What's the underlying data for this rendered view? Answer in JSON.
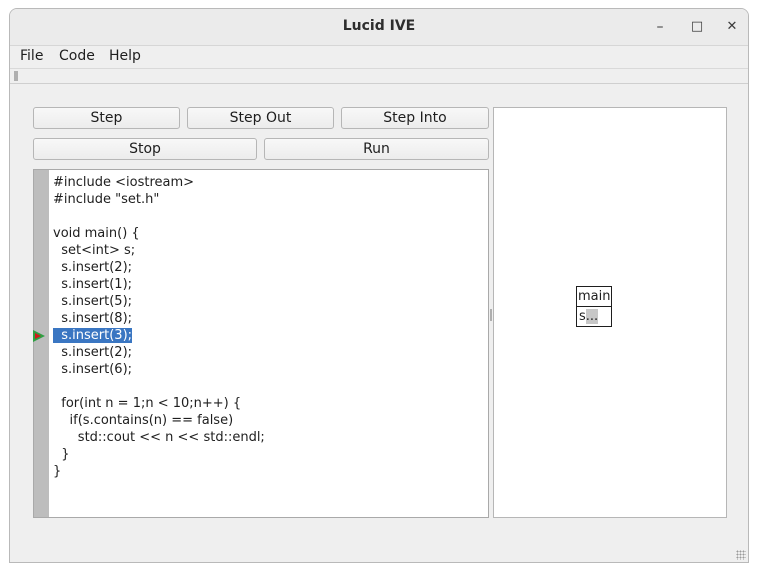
{
  "window": {
    "title": "Lucid IVE",
    "controls": {
      "minimize": "–",
      "maximize": "□",
      "close": "✕"
    }
  },
  "menu": {
    "file": "File",
    "code": "Code",
    "help": "Help"
  },
  "buttons": {
    "step": "Step",
    "step_out": "Step Out",
    "step_into": "Step Into",
    "stop": "Stop",
    "run": "Run"
  },
  "editor": {
    "current_line_index": 9,
    "breakpoint_color": "#2ea043",
    "current_marker_color": "#d11a1a",
    "lines": [
      "#include <iostream>",
      "#include \"set.h\"",
      "",
      "void main() {",
      "  set<int> s;",
      "  s.insert(2);",
      "  s.insert(1);",
      "  s.insert(5);",
      "  s.insert(8);",
      "  s.insert(3);",
      "  s.insert(2);",
      "  s.insert(6);",
      "",
      "  for(int n = 1;n < 10;n++) {",
      "    if(s.contains(n) == false)",
      "      std::cout << n << std::endl;",
      "  }",
      "}"
    ]
  },
  "visualization": {
    "frame_title": "main",
    "variables": [
      {
        "name": "s",
        "value": "..."
      }
    ]
  }
}
